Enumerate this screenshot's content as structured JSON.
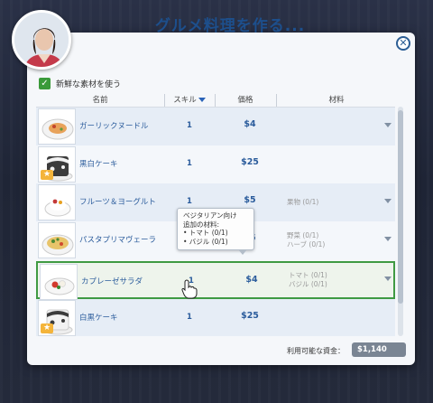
{
  "dialog": {
    "title": "グルメ料理を作る...",
    "close_icon": "close-icon",
    "fresh_option": {
      "checked": true,
      "label": "新鮮な素材を使う"
    }
  },
  "columns": {
    "name": "名前",
    "skill": "スキル",
    "price": "価格",
    "ingredients": "材料"
  },
  "recipes": [
    {
      "name": "ガーリックヌードル",
      "skill": "1",
      "price": "$4",
      "ingredients": [
        "",
        ""
      ],
      "starred": false,
      "dish": "noodle-dish-icon"
    },
    {
      "name": "黒白ケーキ",
      "skill": "1",
      "price": "$25",
      "ingredients": [
        "",
        ""
      ],
      "starred": true,
      "dish": "cake-dish-icon"
    },
    {
      "name": "フルーツ＆ヨーグルト",
      "skill": "1",
      "price": "$5",
      "ingredients": [
        "果物 (0/1)",
        ""
      ],
      "starred": false,
      "dish": "yogurt-dish-icon"
    },
    {
      "name": "パスタプリマヴェーラ",
      "skill": "1",
      "price": "$5",
      "ingredients": [
        "野菜 (0/1)",
        "ハーブ (0/1)"
      ],
      "starred": false,
      "dish": "pasta-dish-icon"
    },
    {
      "name": "カプレーゼサラダ",
      "skill": "1",
      "price": "$4",
      "ingredients": [
        "トマト (0/1)",
        "バジル (0/1)"
      ],
      "starred": false,
      "dish": "salad-dish-icon"
    },
    {
      "name": "白黒ケーキ",
      "skill": "1",
      "price": "$25",
      "ingredients": [
        "",
        ""
      ],
      "starred": true,
      "dish": "cake-dish-icon"
    }
  ],
  "selected_index": 4,
  "tooltip": {
    "title": "ベジタリアン向け",
    "subtitle": "追加の材料:",
    "items": [
      "• トマト (0/1)",
      "• バジル (0/1)"
    ]
  },
  "funds": {
    "label": "利用可能な資金：",
    "value": "$1,140"
  },
  "colors": {
    "accent": "#1d4f8c",
    "selection": "#3f9a43",
    "star": "#f4b43a"
  }
}
